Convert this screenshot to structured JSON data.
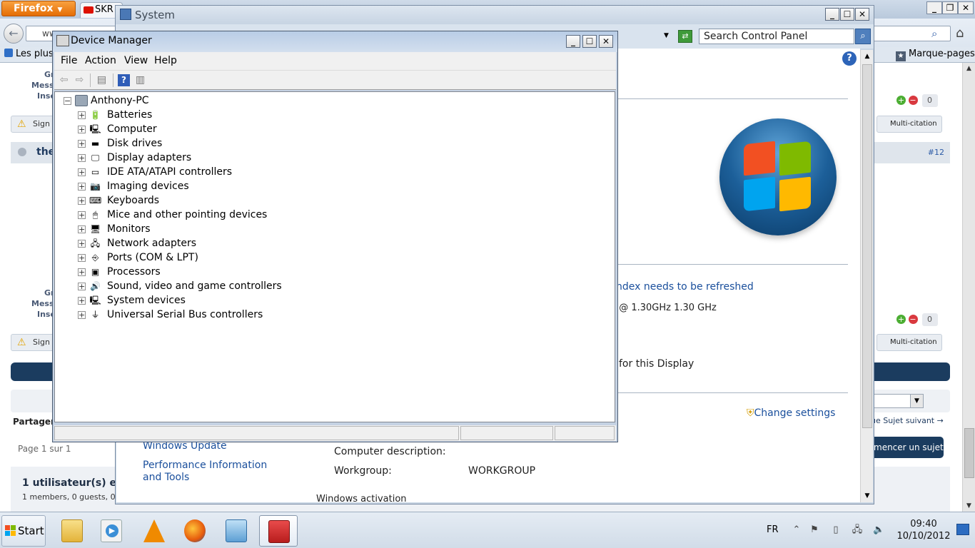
{
  "firefox": {
    "menu_button": "Firefox",
    "tab_label": "SKR",
    "url_fragment": "ww",
    "bookmark_left": "Les plus",
    "bookmark_right": "Marque-pages",
    "forum": {
      "post1_side": [
        "Gr",
        "Mess",
        "Insc"
      ],
      "post2_side": [
        "Gr",
        "Mess",
        "Insc"
      ],
      "signal_label": "Sign",
      "multiquote_label": "Multi-citation",
      "reputation_count": "0",
      "author_name": "the",
      "post_number": "#12",
      "share_label": "Partager",
      "topic_nav": "ue    Sujet suivant →",
      "page_info": "Page 1 sur 1",
      "new_topic_button": "mencer un sujet",
      "online_title": "1 utilisateur(s) en",
      "online_detail": "1 members, 0 guests, 0 an"
    },
    "colors": {
      "brand_dark": "#1b3c5f",
      "firefox_orange": "#e56d05"
    }
  },
  "system_window": {
    "title": "System",
    "search_placeholder": "Search Control Panel",
    "index_link": "ndex needs to be refreshed",
    "processor_text": ") @ 1.30GHz   1.30 GHz",
    "display_text": "for this Display",
    "change_settings_link": "Change settings",
    "windows_update_link": "Windows Update",
    "performance_link": "Performance Information and Tools",
    "computer_description_label": "Computer description:",
    "workgroup_label": "Workgroup:",
    "workgroup_value": "WORKGROUP",
    "activation_heading": "Windows activation"
  },
  "device_manager": {
    "title": "Device Manager",
    "menu": [
      "File",
      "Action",
      "View",
      "Help"
    ],
    "root": "Anthony-PC",
    "items": [
      {
        "label": "Batteries",
        "icon": "battery-icon"
      },
      {
        "label": "Computer",
        "icon": "computer-icon"
      },
      {
        "label": "Disk drives",
        "icon": "disk-drive-icon"
      },
      {
        "label": "Display adapters",
        "icon": "display-adapter-icon"
      },
      {
        "label": "IDE ATA/ATAPI controllers",
        "icon": "ide-controller-icon"
      },
      {
        "label": "Imaging devices",
        "icon": "camera-icon"
      },
      {
        "label": "Keyboards",
        "icon": "keyboard-icon"
      },
      {
        "label": "Mice and other pointing devices",
        "icon": "mouse-icon"
      },
      {
        "label": "Monitors",
        "icon": "monitor-icon"
      },
      {
        "label": "Network adapters",
        "icon": "network-adapter-icon"
      },
      {
        "label": "Ports (COM & LPT)",
        "icon": "port-icon"
      },
      {
        "label": "Processors",
        "icon": "processor-icon"
      },
      {
        "label": "Sound, video and game controllers",
        "icon": "speaker-icon"
      },
      {
        "label": "System devices",
        "icon": "system-device-icon"
      },
      {
        "label": "Universal Serial Bus controllers",
        "icon": "usb-icon"
      }
    ]
  },
  "taskbar": {
    "start_label": "Start",
    "apps": [
      "windows-explorer-icon",
      "media-player-icon",
      "vlc-icon",
      "firefox-icon",
      "control-panel-icon",
      "device-manager-icon"
    ],
    "language": "FR",
    "time": "09:40",
    "date": "10/10/2012"
  }
}
